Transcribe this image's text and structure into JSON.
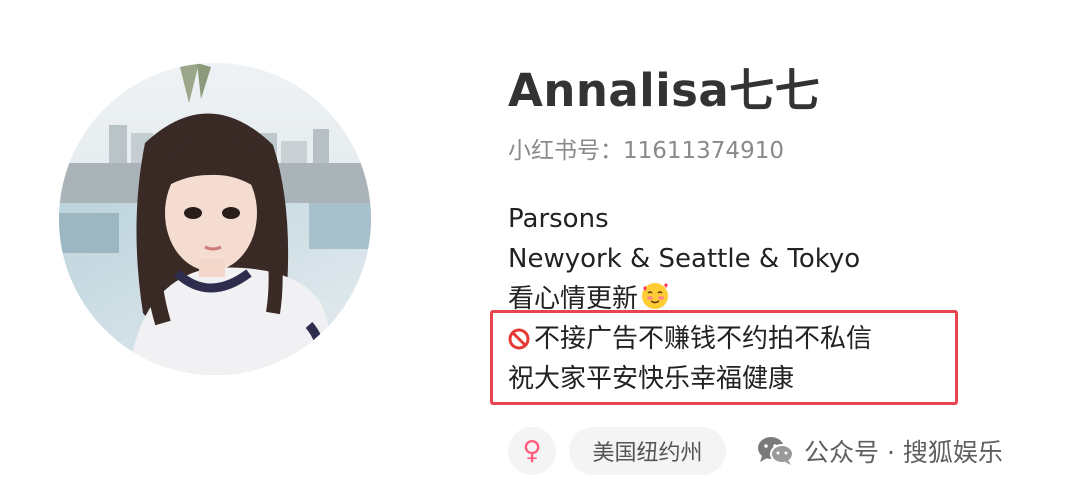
{
  "profile": {
    "username": "Annalisa七七",
    "redid": "小红书号：11611374910",
    "bio": {
      "line1": "Parsons",
      "line2": "Newyork & Seattle & Tokyo",
      "line3": "看心情更新",
      "line3_emoji": "smiling-face-with-hearts-icon",
      "line4_icon": "prohibited-icon",
      "line4": "不接广告不赚钱不约拍不私信",
      "line5": "祝大家平安快乐幸福健康"
    },
    "tags": {
      "gender_symbol": "♀",
      "location": "美国纽约州"
    }
  },
  "watermark": {
    "icon": "wechat-icon",
    "text": "公众号 · 搜狐娱乐"
  },
  "colors": {
    "highlight_border": "#e8454f",
    "gender_female": "#ff5c7c",
    "tag_background": "#f4f4f4",
    "username_text": "#333333"
  }
}
